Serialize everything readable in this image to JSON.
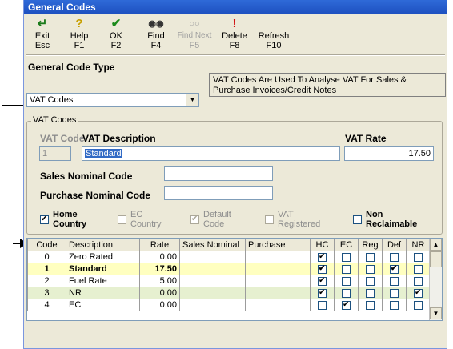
{
  "window": {
    "title": "General Codes"
  },
  "toolbar": {
    "buttons": [
      {
        "label": "Exit",
        "shortcut": "Esc",
        "icon": "exit-icon",
        "glyph": "↵",
        "color": "#1a7a1a",
        "enabled": true
      },
      {
        "label": "Help",
        "shortcut": "F1",
        "icon": "help-icon",
        "glyph": "?",
        "color": "#c8a000",
        "enabled": true
      },
      {
        "label": "OK",
        "shortcut": "F2",
        "icon": "ok-check-icon",
        "glyph": "✔",
        "color": "#1a8a1a",
        "enabled": true
      },
      {
        "label": "Find",
        "shortcut": "F4",
        "icon": "binoculars-icon",
        "glyph": "◉◉",
        "color": "#333333",
        "enabled": true
      },
      {
        "label": "Find Next",
        "shortcut": "F5",
        "icon": "binoculars-next-icon",
        "glyph": "○○",
        "color": "#a0a0a0",
        "enabled": false
      },
      {
        "label": "Delete",
        "shortcut": "F8",
        "icon": "delete-icon",
        "glyph": "!",
        "color": "#d01010",
        "enabled": true
      },
      {
        "label": "Refresh",
        "shortcut": "F10",
        "icon": "refresh-icon",
        "glyph": "",
        "color": "#000000",
        "enabled": true
      }
    ]
  },
  "code_type": {
    "label": "General Code Type",
    "value": "VAT Codes",
    "description": "VAT Codes Are Used To Analyse VAT For Sales & Purchase Invoices/Credit Notes"
  },
  "vat_group": {
    "title": "VAT Codes",
    "vat_code_label": "VAT Code",
    "vat_code_value": "1",
    "vat_description_label": "VAT Description",
    "vat_description_value": "Standard",
    "vat_rate_label": "VAT Rate",
    "vat_rate_value": "17.50",
    "sales_nominal_label": "Sales Nominal Code",
    "sales_nominal_value": "",
    "purchase_nominal_label": "Purchase Nominal Code",
    "purchase_nominal_value": "",
    "flags": {
      "home_country": {
        "line1": "Home",
        "line2": "Country",
        "checked": true,
        "enabled": true
      },
      "ec_country": {
        "line1": "EC",
        "line2": "Country",
        "checked": false,
        "enabled": false
      },
      "default_code": {
        "line1": "Default",
        "line2": "Code",
        "checked": true,
        "enabled": false
      },
      "vat_registered": {
        "line1": "VAT",
        "line2": "Registered",
        "checked": false,
        "enabled": false
      },
      "non_reclaimable": {
        "line1": "Non",
        "line2": "Reclaimable",
        "checked": false,
        "enabled": true
      }
    }
  },
  "grid": {
    "columns": [
      "Code",
      "Description",
      "Rate",
      "Sales Nominal",
      "Purchase",
      "HC",
      "EC",
      "Reg",
      "Def",
      "NR"
    ],
    "selected_index": 1,
    "rows": [
      {
        "code": "0",
        "description": "Zero Rated",
        "rate": "0.00",
        "sales_nominal": "",
        "purchase": "",
        "hc": true,
        "ec": false,
        "reg": false,
        "def": false,
        "nr": false
      },
      {
        "code": "1",
        "description": "Standard",
        "rate": "17.50",
        "sales_nominal": "",
        "purchase": "",
        "hc": true,
        "ec": false,
        "reg": false,
        "def": true,
        "nr": false
      },
      {
        "code": "2",
        "description": "Fuel Rate",
        "rate": "5.00",
        "sales_nominal": "",
        "purchase": "",
        "hc": true,
        "ec": false,
        "reg": false,
        "def": false,
        "nr": false
      },
      {
        "code": "3",
        "description": "NR",
        "rate": "0.00",
        "sales_nominal": "",
        "purchase": "",
        "hc": true,
        "ec": false,
        "reg": false,
        "def": false,
        "nr": true
      },
      {
        "code": "4",
        "description": "EC",
        "rate": "0.00",
        "sales_nominal": "",
        "purchase": "",
        "hc": false,
        "ec": true,
        "reg": false,
        "def": false,
        "nr": false
      }
    ]
  }
}
